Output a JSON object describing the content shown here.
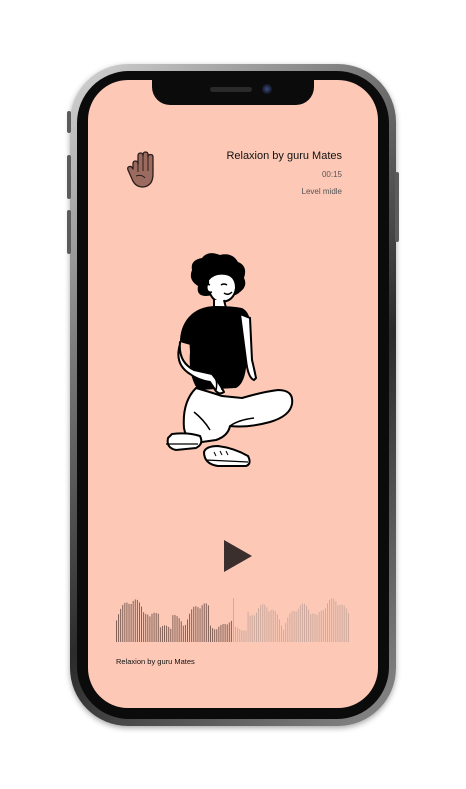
{
  "track": {
    "title": "Relaxion by guru Mates",
    "time": "00:15",
    "level": "Level midle"
  },
  "footer": {
    "label": "Relaxion by guru Mates"
  },
  "icons": {
    "hand": "hand-icon",
    "play": "play-icon"
  },
  "player": {
    "progress": 0.5
  },
  "colors": {
    "screen_background": "#fdc9b6",
    "hand_fill": "#9c6b5f",
    "waveform_played": "#7a5a52",
    "waveform_remaining": "#c9a89d",
    "play_button": "#3a2f2d"
  }
}
